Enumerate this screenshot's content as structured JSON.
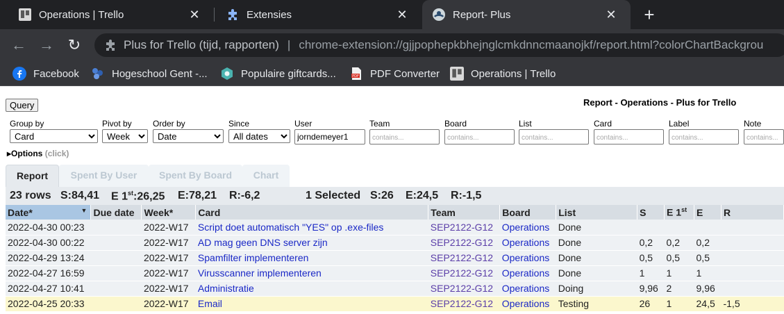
{
  "browser": {
    "tabs": [
      {
        "title": "Operations | Trello"
      },
      {
        "title": "Extensies"
      },
      {
        "title": "Report- Plus"
      }
    ],
    "omnibox": {
      "site": "Plus for Trello (tijd, rapporten)",
      "separator": "|",
      "url": "chrome-extension://gjjpophepkbhejnglcmkdnncmaanojkf/report.html?colorChartBackgrou"
    },
    "bookmarks": [
      {
        "label": "Facebook"
      },
      {
        "label": "Hogeschool Gent -..."
      },
      {
        "label": "Populaire giftcards..."
      },
      {
        "label": "PDF Converter"
      },
      {
        "label": "Operations | Trello"
      }
    ]
  },
  "report": {
    "query_label": "Query",
    "title": "Report - Operations - Plus for Trello",
    "filters": {
      "group_by": {
        "label": "Group by",
        "value": "Card"
      },
      "pivot_by": {
        "label": "Pivot by",
        "value": "Week"
      },
      "order_by": {
        "label": "Order by",
        "value": "Date"
      },
      "since": {
        "label": "Since",
        "value": "All dates"
      },
      "user": {
        "label": "User",
        "value": "jorndemeyer1"
      },
      "team": {
        "label": "Team",
        "placeholder": "contains..."
      },
      "board": {
        "label": "Board",
        "placeholder": "contains..."
      },
      "list": {
        "label": "List",
        "placeholder": "contains..."
      },
      "card": {
        "label": "Card",
        "placeholder": "contains..."
      },
      "label": {
        "label": "Label",
        "placeholder": "contains..."
      },
      "note": {
        "label": "Note",
        "placeholder": "contains..."
      }
    },
    "options": {
      "label": "Options",
      "hint": "(click)"
    },
    "tabs": [
      "Report",
      "Spent By User",
      "Spent By Board",
      "Chart"
    ],
    "summary": {
      "rows": "23 rows",
      "s": "S:84,41",
      "e1st": "E 1st:26,25",
      "e": "E:78,21",
      "r": "R:-6,2",
      "selected": "1 Selected",
      "sel_s": "S:26",
      "sel_e": "E:24,5",
      "sel_r": "R:-1,5"
    },
    "columns": {
      "date": "Date*",
      "due": "Due date",
      "week": "Week*",
      "card": "Card",
      "team": "Team",
      "board": "Board",
      "list": "List",
      "s": "S",
      "e1": "E 1",
      "e1sup": "st",
      "e": "E",
      "r": "R"
    },
    "rows": [
      {
        "date": "2022-04-30 00:23",
        "due": "",
        "week": "2022-W17",
        "card": "Script doet automatisch \"YES\" op .exe-files",
        "team": "SEP2122-G12",
        "board": "Operations",
        "list": "Done",
        "s": "",
        "e1": "",
        "e": "",
        "r": ""
      },
      {
        "date": "2022-04-30 00:22",
        "due": "",
        "week": "2022-W17",
        "card": "AD mag geen DNS server zijn",
        "team": "SEP2122-G12",
        "board": "Operations",
        "list": "Done",
        "s": "0,2",
        "e1": "0,2",
        "e": "0,2",
        "r": ""
      },
      {
        "date": "2022-04-29 13:24",
        "due": "",
        "week": "2022-W17",
        "card": "Spamfilter implementeren",
        "team": "SEP2122-G12",
        "board": "Operations",
        "list": "Done",
        "s": "0,5",
        "e1": "0,5",
        "e": "0,5",
        "r": ""
      },
      {
        "date": "2022-04-27 16:59",
        "due": "",
        "week": "2022-W17",
        "card": "Virusscanner implementeren",
        "team": "SEP2122-G12",
        "board": "Operations",
        "list": "Done",
        "s": "1",
        "e1": "1",
        "e": "1",
        "r": ""
      },
      {
        "date": "2022-04-27 10:41",
        "due": "",
        "week": "2022-W17",
        "card": "Administratie",
        "team": "SEP2122-G12",
        "board": "Operations",
        "list": "Doing",
        "s": "9,96",
        "e1": "2",
        "e": "9,96",
        "r": ""
      },
      {
        "date": "2022-04-25 20:33",
        "due": "",
        "week": "2022-W17",
        "card": "Email",
        "team": "SEP2122-G12",
        "board": "Operations",
        "list": "Testing",
        "s": "26",
        "e1": "1",
        "e": "24,5",
        "r": "-1,5",
        "selected": true
      }
    ]
  }
}
